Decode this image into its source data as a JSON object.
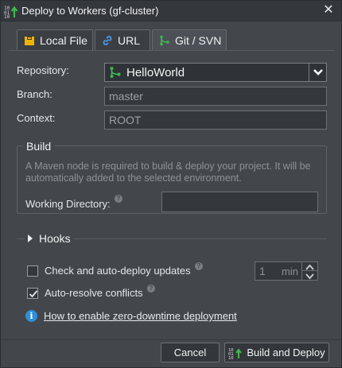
{
  "window": {
    "title": "Deploy to Workers (gf-cluster)",
    "close_icon": "close-icon",
    "title_icon": "deploy-arrow-icon"
  },
  "tabs": [
    {
      "label": "Local File",
      "icon": "folder-icon",
      "active": false
    },
    {
      "label": "URL",
      "icon": "link-icon",
      "active": false
    },
    {
      "label": "Git / SVN",
      "icon": "git-icon",
      "active": true
    }
  ],
  "form": {
    "repository_label": "Repository:",
    "repository_value": "HelloWorld",
    "branch_label": "Branch:",
    "branch_value": "master",
    "context_label": "Context:",
    "context_value": "ROOT"
  },
  "build": {
    "legend": "Build",
    "info": "A Maven node is required to build & deploy your project. It will be automatically added to the selected environment.",
    "working_dir_label": "Working Directory:",
    "working_dir_value": ""
  },
  "hooks": {
    "label": "Hooks"
  },
  "options": {
    "auto_deploy_label": "Check and auto-deploy updates",
    "auto_deploy_checked": false,
    "interval_value": "1",
    "interval_unit": "min",
    "auto_resolve_label": "Auto-resolve conflicts",
    "auto_resolve_checked": true
  },
  "help": {
    "link_text": "How to enable zero-downtime deployment"
  },
  "buttons": {
    "cancel": "Cancel",
    "build_deploy": "Build and Deploy"
  },
  "colors": {
    "git_green": "#3fb950",
    "info_blue": "#2f8ed8",
    "folder_yellow": "#f0b400",
    "link_blue": "#4c9be8"
  }
}
